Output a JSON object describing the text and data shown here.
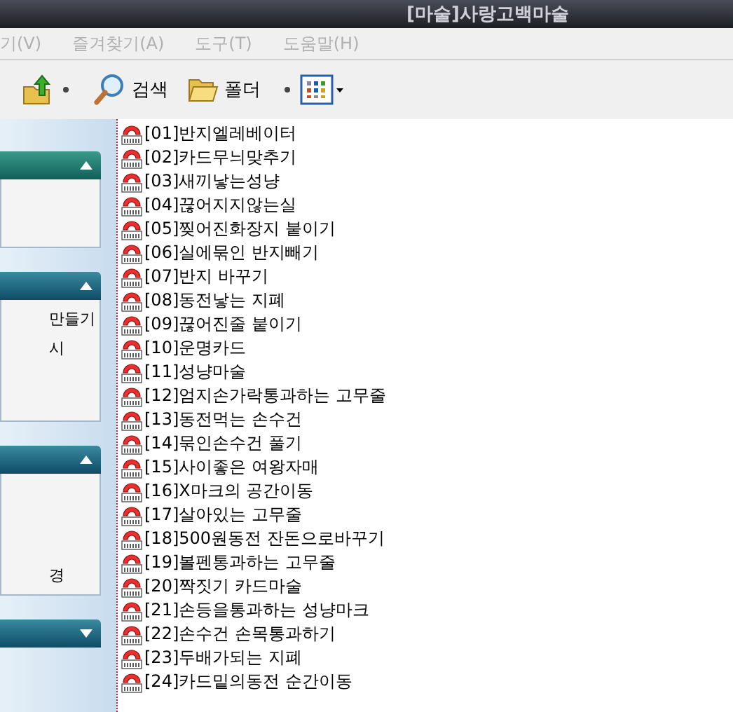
{
  "window": {
    "title": "[마술]사랑고백마술"
  },
  "menu": [
    {
      "label": "기(V)"
    },
    {
      "label": "즐겨찾기(A)"
    },
    {
      "label": "도구(T)"
    },
    {
      "label": "도움말(H)"
    }
  ],
  "toolbar": [
    {
      "kind": "up"
    },
    {
      "kind": "search",
      "label": "검색"
    },
    {
      "kind": "folders",
      "label": "폴더"
    },
    {
      "kind": "views"
    }
  ],
  "sidebar": {
    "panels": [
      {
        "expanded": true
      },
      {
        "expanded": true,
        "items": [
          "만들기",
          "시"
        ]
      },
      {
        "expanded": true,
        "items": [
          "경"
        ]
      },
      {
        "expanded": false
      }
    ]
  },
  "files": [
    "[01]반지엘레베이터",
    "[02]카드무늬맞추기",
    "[03]새끼낳는성냥",
    "[04]끊어지지않는실",
    "[05]찢어진화장지 붙이기",
    "[06]실에묶인 반지빼기",
    "[07]반지 바꾸기",
    "[08]동전낳는 지폐",
    "[09]끊어진줄 붙이기",
    "[10]운명카드",
    "[11]성냥마술",
    "[12]엄지손가락통과하는 고무줄",
    "[13]동전먹는 손수건",
    "[14]묶인손수건 풀기",
    "[15]사이좋은 여왕자매",
    "[16]X마크의 공간이동",
    "[17]살아있는 고무줄",
    "[18]500원동전 잔돈으로바꾸기",
    "[19]볼펜통과하는 고무줄",
    "[20]짝짓기 카드마술",
    "[21]손등을통과하는 성냥마크",
    "[22]손수건 손목통과하기",
    "[23]두배가되는 지폐",
    "[24]카드밑의동전 순간이동"
  ]
}
